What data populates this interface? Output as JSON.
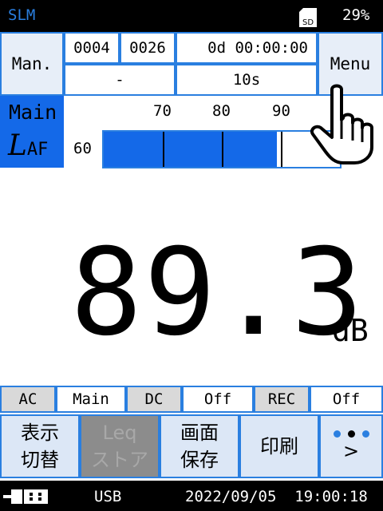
{
  "status": {
    "app_title": "SLM",
    "sd_label": "SD",
    "battery": "29%"
  },
  "header": {
    "mode_button": "Man.",
    "field_1": "0004",
    "field_2": "0026",
    "elapsed": "0d 00:00:00",
    "sub_left": "-",
    "interval": "10s",
    "menu_button": "Menu"
  },
  "meter": {
    "label_main": "Main",
    "label_weight": "AF",
    "scale_start": "60",
    "scale_ticks": [
      "70",
      "80",
      "90"
    ],
    "level_db": 89.3,
    "scale_min": 60,
    "scale_max": 100
  },
  "reading": {
    "value": "89.3",
    "unit": "dB"
  },
  "status_row": {
    "ac_label": "AC",
    "ac_value": "Main",
    "dc_label": "DC",
    "dc_value": "Off",
    "rec_label": "REC",
    "rec_value": "Off"
  },
  "softkeys": {
    "display_switch_l1": "表示",
    "display_switch_l2": "切替",
    "leq_store_l1": "Leq",
    "leq_store_l2": "ストア",
    "screen_save_l1": "画面",
    "screen_save_l2": "保存",
    "print": "印刷",
    "next": ">"
  },
  "footer": {
    "connection": "USB",
    "datetime": "2022/09/05  19:00:18"
  },
  "colors": {
    "accent": "#2a7fe0",
    "bar_fill": "#1469e8",
    "key_bg": "#dce7f6"
  }
}
